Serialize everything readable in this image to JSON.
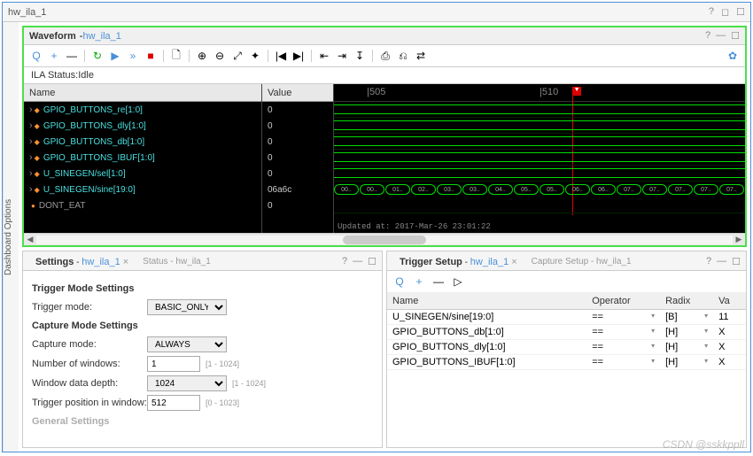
{
  "window": {
    "title": "hw_ila_1"
  },
  "sidebar": {
    "label": "Dashboard Options"
  },
  "waveform": {
    "title": "Waveform",
    "subtitle": "hw_ila_1",
    "status_label": "ILA Status:Idle",
    "name_header": "Name",
    "value_header": "Value",
    "signals": [
      {
        "name": "GPIO_BUTTONS_re[1:0]",
        "value": "0"
      },
      {
        "name": "GPIO_BUTTONS_dly[1:0]",
        "value": "0"
      },
      {
        "name": "GPIO_BUTTONS_db[1:0]",
        "value": "0"
      },
      {
        "name": "GPIO_BUTTONS_IBUF[1:0]",
        "value": "0"
      },
      {
        "name": "U_SINEGEN/sel[1:0]",
        "value": "0"
      },
      {
        "name": "U_SINEGEN/sine[19:0]",
        "value": "06a6c"
      },
      {
        "name": "DONT_EAT",
        "value": "0"
      }
    ],
    "ruler": {
      "t1": "|505",
      "t2": "|510",
      "marker_pos": "58%"
    },
    "bus_segments": [
      "00..",
      "00..",
      "01..",
      "02..",
      "03..",
      "03..",
      "04..",
      "05..",
      "05..",
      "06..",
      "06..",
      "07..",
      "07..",
      "07..",
      "07..",
      "07.."
    ],
    "updated": "Updated at: 2017-Mar-26 23:01:22"
  },
  "settings": {
    "tab1_title": "Settings",
    "tab1_sub": "hw_ila_1",
    "tab2_title": "Status - hw_ila_1",
    "trigger_section": "Trigger Mode Settings",
    "trigger_mode_label": "Trigger mode:",
    "trigger_mode_value": "BASIC_ONLY",
    "capture_section": "Capture Mode Settings",
    "capture_mode_label": "Capture mode:",
    "capture_mode_value": "ALWAYS",
    "num_windows_label": "Number of windows:",
    "num_windows_value": "1",
    "num_windows_hint": "[1 - 1024]",
    "depth_label": "Window data depth:",
    "depth_value": "1024",
    "depth_hint": "[1 - 1024]",
    "trig_pos_label": "Trigger position in window:",
    "trig_pos_value": "512",
    "trig_pos_hint": "[0 - 1023]",
    "general_section": "General Settings"
  },
  "trigger": {
    "tab1_title": "Trigger Setup",
    "tab1_sub": "hw_ila_1",
    "tab2_title": "Capture Setup - hw_ila_1",
    "col_name": "Name",
    "col_op": "Operator",
    "col_radix": "Radix",
    "col_val": "Va",
    "rows": [
      {
        "name": "U_SINEGEN/sine[19:0]",
        "op": "==",
        "radix": "[B]",
        "val": "11"
      },
      {
        "name": "GPIO_BUTTONS_db[1:0]",
        "op": "==",
        "radix": "[H]",
        "val": "X"
      },
      {
        "name": "GPIO_BUTTONS_dly[1:0]",
        "op": "==",
        "radix": "[H]",
        "val": "X"
      },
      {
        "name": "GPIO_BUTTONS_IBUF[1:0]",
        "op": "==",
        "radix": "[H]",
        "val": "X"
      }
    ]
  },
  "watermark": "CSDN @sskkppll"
}
